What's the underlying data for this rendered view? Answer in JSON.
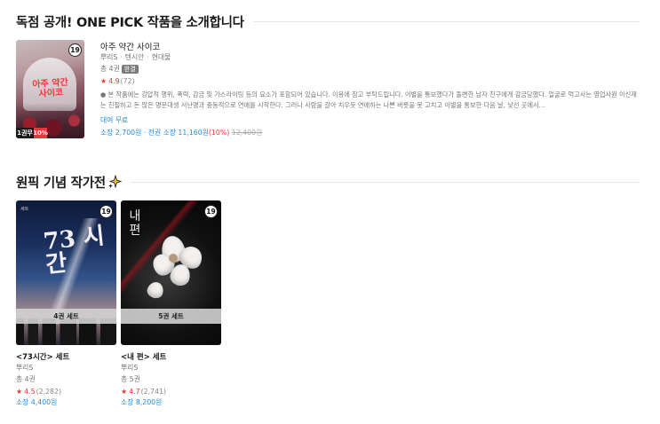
{
  "section1": {
    "title": "독점 공개! ONE PICK 작품을 소개합니다"
  },
  "featured": {
    "cover_title": "아주 약간 사이코",
    "age": "19",
    "episode_badge": "1권무",
    "discount_badge": "10%",
    "title": "아주 약간 사이코",
    "author": "뿌리S",
    "genre": "텐시안",
    "category": "현대물",
    "total": "총 4권",
    "status": "완결",
    "rating": "4.9",
    "rating_count": "(72)",
    "description": "● 본 작품에는 강압적 행위, 폭력, 감금 및 가스라이팅 등의 요소가 포함되어 있습니다. 이용에 참고 부탁드립니다. 이별을 통보했다가 돌변한 남자 친구에게 감금당했다. 얼굴로 먹고사는 영업사원 이신재는 친절하고 돈 많은 명문대생 서난명과 충동적으로 연애를 시작한다. 그러나 사람을 갈아 치우듯 연애하는 나쁜 버릇을 못 고치고 이별을 통보한 다음 날, 낯선 곳에서...",
    "free_label": "대여 무료",
    "price_label": "소장 2,700원",
    "set_price": "· 전권 소장 11,160원",
    "set_discount": "(10%)",
    "original_price": "12,400원"
  },
  "section2": {
    "title": "원픽 기념 작가전"
  },
  "sets": [
    {
      "cover_text": "73 시간",
      "cover_tag": "세트",
      "age": "19",
      "set_label": "4권 세트",
      "title": "<73시간> 세트",
      "author": "뿌리S",
      "total": "총 4권",
      "rating": "4.5",
      "rating_count": "(2,282)",
      "price": "소장 4,400원"
    },
    {
      "cover_text": "내 편",
      "age": "19",
      "set_label": "5권 세트",
      "title": "<내 편> 세트",
      "author": "뿌리S",
      "total": "총 5권",
      "rating": "4.7",
      "rating_count": "(2,741)",
      "price": "소장 8,200원"
    }
  ],
  "colors": {
    "accent_blue": "#1f8ce6",
    "rating_red": "#e23b3b"
  },
  "icons": {
    "star": "star-icon",
    "sparkle": "sparkle-icon"
  }
}
